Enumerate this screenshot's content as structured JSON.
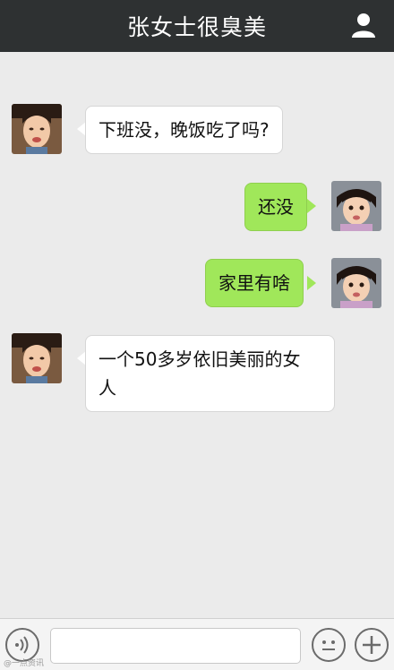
{
  "header": {
    "title": "张女士很臭美",
    "profile_icon": "person-icon"
  },
  "messages": [
    {
      "side": "left",
      "text": "下班没，晚饭吃了吗?",
      "avatar": "avatar-woman-a"
    },
    {
      "side": "right",
      "text": "还没",
      "avatar": "avatar-girl-b"
    },
    {
      "side": "right",
      "text": "家里有啥",
      "avatar": "avatar-girl-b"
    },
    {
      "side": "left",
      "text_line1": "一个50多岁依旧美丽的女",
      "text_line2": "人",
      "avatar": "avatar-woman-a"
    }
  ],
  "input_bar": {
    "voice_icon": "voice-icon",
    "emoji_icon": "emoji-icon",
    "plus_icon": "plus-icon",
    "input_value": ""
  },
  "watermark_text": "@一点资讯",
  "colors": {
    "header_bg": "#2e3132",
    "chat_bg": "#ebebeb",
    "sent_bubble": "#a0e75a",
    "received_bubble": "#ffffff"
  }
}
